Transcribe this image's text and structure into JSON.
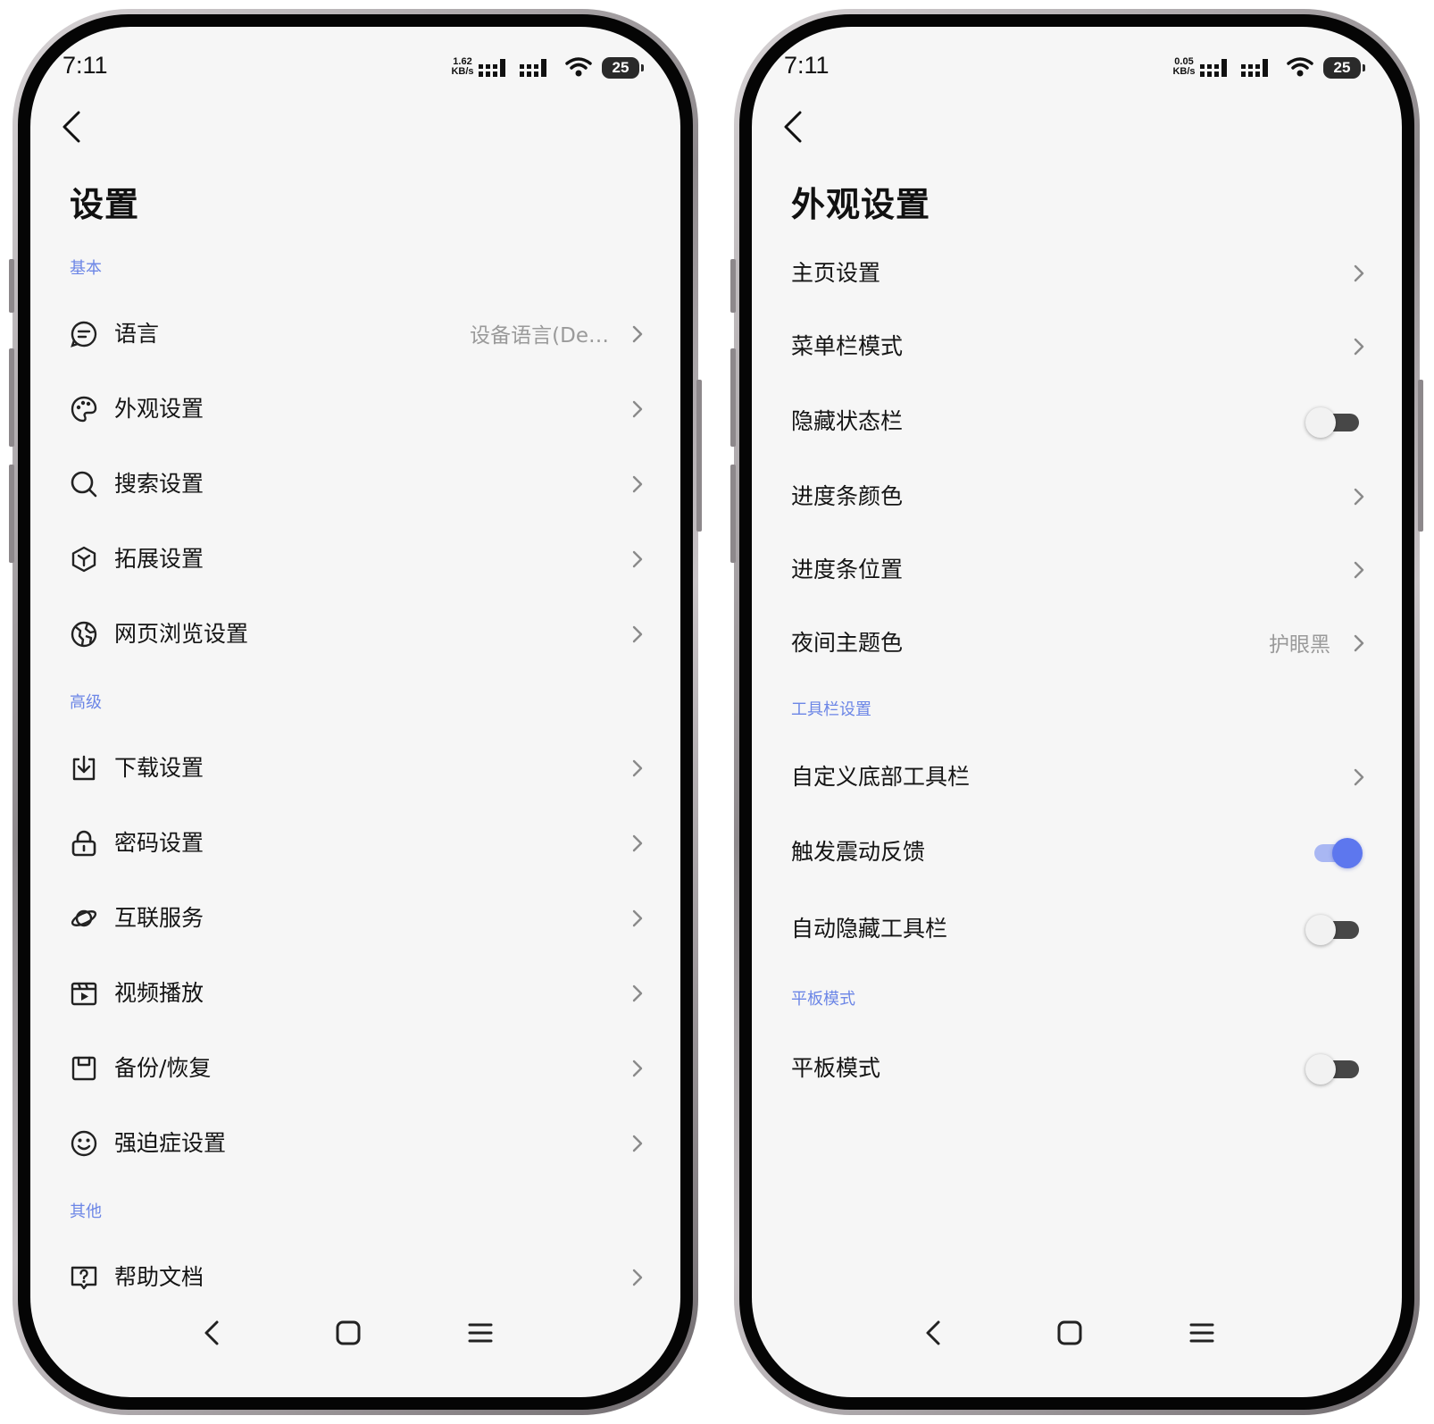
{
  "left": {
    "status": {
      "time": "7:11",
      "speed_value": "1.62",
      "speed_unit": "KB/s",
      "battery": "25"
    },
    "title": "设置",
    "sections": [
      {
        "label": "基本",
        "items": [
          {
            "icon": "language-icon",
            "label": "语言",
            "value": "设备语言(De…"
          },
          {
            "icon": "palette-icon",
            "label": "外观设置"
          },
          {
            "icon": "search-icon",
            "label": "搜索设置"
          },
          {
            "icon": "extension-cube-icon",
            "label": "拓展设置"
          },
          {
            "icon": "globe-browse-icon",
            "label": "网页浏览设置"
          }
        ]
      },
      {
        "label": "高级",
        "items": [
          {
            "icon": "download-icon",
            "label": "下载设置"
          },
          {
            "icon": "lock-icon",
            "label": "密码设置"
          },
          {
            "icon": "planet-icon",
            "label": "互联服务"
          },
          {
            "icon": "video-play-icon",
            "label": "视频播放"
          },
          {
            "icon": "save-disk-icon",
            "label": "备份/恢复"
          },
          {
            "icon": "smiley-icon",
            "label": "强迫症设置"
          }
        ]
      },
      {
        "label": "其他",
        "items": [
          {
            "icon": "help-doc-icon",
            "label": "帮助文档"
          }
        ]
      }
    ]
  },
  "right": {
    "status": {
      "time": "7:11",
      "speed_value": "0.05",
      "speed_unit": "KB/s",
      "battery": "25"
    },
    "title": "外观设置",
    "items": [
      {
        "label": "主页设置",
        "control": "chevron"
      },
      {
        "label": "菜单栏模式",
        "control": "chevron"
      },
      {
        "label": "隐藏状态栏",
        "control": "toggle",
        "on": false
      },
      {
        "label": "进度条颜色",
        "control": "chevron"
      },
      {
        "label": "进度条位置",
        "control": "chevron"
      },
      {
        "label": "夜间主题色",
        "control": "chevron",
        "value": "护眼黑"
      }
    ],
    "toolbar_section": {
      "label": "工具栏设置",
      "items": [
        {
          "label": "自定义底部工具栏",
          "control": "chevron"
        },
        {
          "label": "触发震动反馈",
          "control": "toggle",
          "on": true
        },
        {
          "label": "自动隐藏工具栏",
          "control": "toggle",
          "on": false
        }
      ]
    },
    "tablet_section": {
      "label": "平板模式",
      "items": [
        {
          "label": "平板模式",
          "control": "toggle",
          "on": false
        }
      ]
    }
  },
  "colors": {
    "accent": "#5d77ee",
    "section_label": "#6c86e6",
    "background": "#f6f6f6"
  }
}
